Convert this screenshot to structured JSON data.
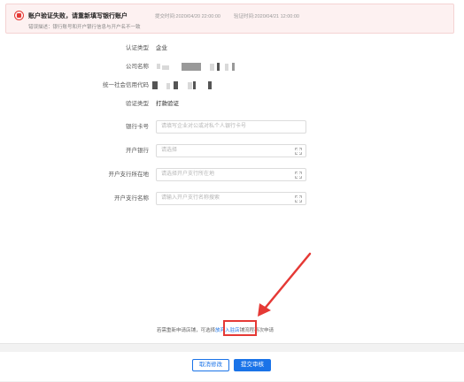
{
  "alert": {
    "title": "账户验证失败，请重新填写银行账户",
    "submit_time": "提交时间:2020/04/20 22:00:00",
    "verify_time": "验证时间:2020/04/21 12:00:00",
    "detail": "错误描述：银行账号和开户银行信息与开户名不一致"
  },
  "form": {
    "cert_type": {
      "label": "认证类型",
      "value": "企业"
    },
    "company_name": {
      "label": "公司名称"
    },
    "credit_code": {
      "label": "统一社会信用代码"
    },
    "verify_type": {
      "label": "验证类型",
      "value": "打款验证"
    },
    "bank_card": {
      "label": "银行卡号",
      "placeholder": "请填写企业对公或对私个人银行卡号"
    },
    "bank": {
      "label": "开户银行",
      "placeholder": "请选择"
    },
    "branch_location": {
      "label": "开户支行所在地",
      "placeholder": "请选择开户支行所在地"
    },
    "branch_name": {
      "label": "开户支行名称",
      "placeholder": "请输入开户支行名称搜索"
    }
  },
  "hint": {
    "prefix": "若需重新申请店铺，可选择",
    "link": "放弃入驻店",
    "suffix": "铺流程再次申请"
  },
  "footer": {
    "cancel_label": "取消修改",
    "submit_label": "提交审核"
  },
  "colors": {
    "accent": "#1a73e8",
    "error": "#e53935",
    "alert_bg": "#fdf1f1"
  }
}
